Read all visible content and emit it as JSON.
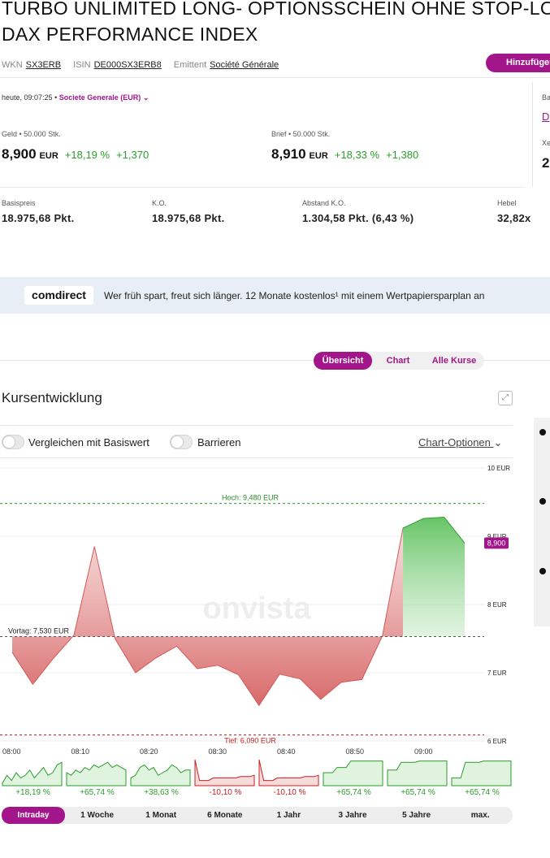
{
  "header": {
    "title_line1": "TURBO UNLIMITED LONG- OPTIONSSCHEIN OHNE STOP-LOSS",
    "title_line2": "DAX PERFORMANCE INDEX",
    "wkn_label": "WKN",
    "wkn": "SX3ERB",
    "isin_label": "ISIN",
    "isin": "DE000SX3ERB8",
    "emittent_label": "Emittent",
    "emittent": "Société Générale",
    "add_button": "Hinzufügen"
  },
  "quote": {
    "timestamp": "heute, 09:07:25",
    "separator": "•",
    "exchange": "Societe Generale (EUR)",
    "bid_label": "Geld • 50.000 Stk.",
    "bid_price": "8,900",
    "bid_currency": "EUR",
    "bid_change_pct": "+18,19 %",
    "bid_change_abs": "+1,370",
    "ask_label": "Brief • 50.000 Stk.",
    "ask_price": "8,910",
    "ask_currency": "EUR",
    "ask_change_pct": "+18,33 %",
    "ask_change_abs": "+1,380",
    "side_label1": "Ba",
    "side_link": "D",
    "side_label2": "Xe",
    "side_value": "2"
  },
  "keyfacts": [
    {
      "label": "Basispreis",
      "value": "18.975,68 Pkt."
    },
    {
      "label": "K.O.",
      "value": "18.975,68 Pkt."
    },
    {
      "label": "Abstand K.O.",
      "value": "1.304,58 Pkt. (6,43 %)"
    },
    {
      "label": "Hebel",
      "value": "32,82x"
    }
  ],
  "banner": {
    "brand": "comdirect",
    "text": "Wer früh spart, freut sich länger. 12 Monate kostenlos¹ mit einem Wertpapiersparplan an"
  },
  "tabs": [
    "Übersicht",
    "Chart",
    "Alle Kurse"
  ],
  "section": {
    "title": "Kursentwicklung",
    "toggle_compare": "Vergleichen mit Basiswert",
    "toggle_barriers": "Barrieren",
    "chart_options": "Chart-Optionen"
  },
  "colors": {
    "accent": "#a3168b",
    "up": "#2a9d2a",
    "down": "#c82020"
  },
  "chart_data": {
    "type": "area",
    "watermark": "onvista",
    "currency": "EUR",
    "x": [
      "08:00",
      "08:03",
      "08:06",
      "08:10",
      "08:13",
      "08:17",
      "08:21",
      "08:24",
      "08:28",
      "08:32",
      "08:35",
      "08:39",
      "08:43",
      "08:46",
      "08:50",
      "08:54",
      "08:57",
      "09:00",
      "09:04",
      "09:07"
    ],
    "values": [
      7.3,
      6.83,
      7.21,
      7.55,
      8.85,
      7.5,
      7.0,
      7.22,
      7.39,
      7.06,
      7.11,
      6.97,
      6.52,
      6.98,
      6.91,
      6.61,
      6.86,
      6.9,
      7.54,
      9.12
    ],
    "close_path": [
      9.26,
      9.28,
      8.9
    ],
    "x_ticks": [
      "08:00",
      "08:10",
      "08:20",
      "08:30",
      "08:40",
      "08:50",
      "09:00"
    ],
    "y_ticks": [
      "10 EUR",
      "9 EUR",
      "8 EUR",
      "7 EUR",
      "6 EUR"
    ],
    "ylim": [
      6,
      10
    ],
    "prev_close": 7.53,
    "prev_close_label": "Vortag: 7,530 EUR",
    "high": 9.48,
    "high_label": "Hoch: 9,480 EUR",
    "low": 6.09,
    "low_label": "Tief: 6,090 EUR",
    "last_label": "8,900"
  },
  "periods": [
    {
      "label": "Intraday",
      "change": "+18,19 %",
      "dir": "up"
    },
    {
      "label": "1 Woche",
      "change": "+65,74 %",
      "dir": "up"
    },
    {
      "label": "1 Monat",
      "change": "+38,63 %",
      "dir": "up"
    },
    {
      "label": "6 Monate",
      "change": "-10,10 %",
      "dir": "down"
    },
    {
      "label": "1 Jahr",
      "change": "-10,10 %",
      "dir": "down"
    },
    {
      "label": "3 Jahre",
      "change": "+65,74 %",
      "dir": "up"
    },
    {
      "label": "5 Jahre",
      "change": "+65,74 %",
      "dir": "up"
    },
    {
      "label": "max.",
      "change": "+65,74 %",
      "dir": "up"
    }
  ]
}
